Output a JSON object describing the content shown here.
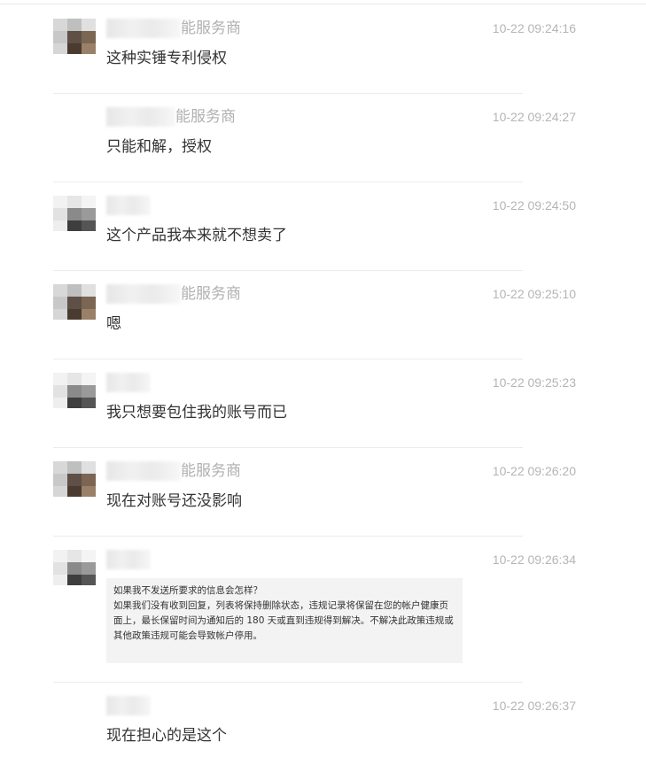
{
  "messages": [
    {
      "sender_suffix": "能服务商",
      "time": "10-22 09:24:16",
      "text": "这种实锤专利侵权"
    },
    {
      "sender_suffix": "能服务商",
      "time": "10-22 09:24:27",
      "text": "只能和解，授权"
    },
    {
      "sender_suffix": "",
      "time": "10-22 09:24:50",
      "text": "这个产品我本来就不想卖了"
    },
    {
      "sender_suffix": "能服务商",
      "time": "10-22 09:25:10",
      "text": "嗯"
    },
    {
      "sender_suffix": "",
      "time": "10-22 09:25:23",
      "text": "我只想要包住我的账号而已"
    },
    {
      "sender_suffix": "能服务商",
      "time": "10-22 09:26:20",
      "text": "现在对账号还没影响"
    },
    {
      "sender_suffix": "",
      "time": "10-22 09:26:34",
      "quote_title": "如果我不发送所要求的信息会怎样？",
      "quote_body": "如果我们没有收到回复，列表将保持删除状态，违规记录将保留在您的帐户健康页面上，最长保留时间为通知后的 180 天或直到违规得到解决。不解决此政策违规或其他政策违规可能会导致帐户停用。"
    },
    {
      "sender_suffix": "",
      "time": "10-22 09:26:37",
      "text": "现在担心的是这个"
    }
  ]
}
